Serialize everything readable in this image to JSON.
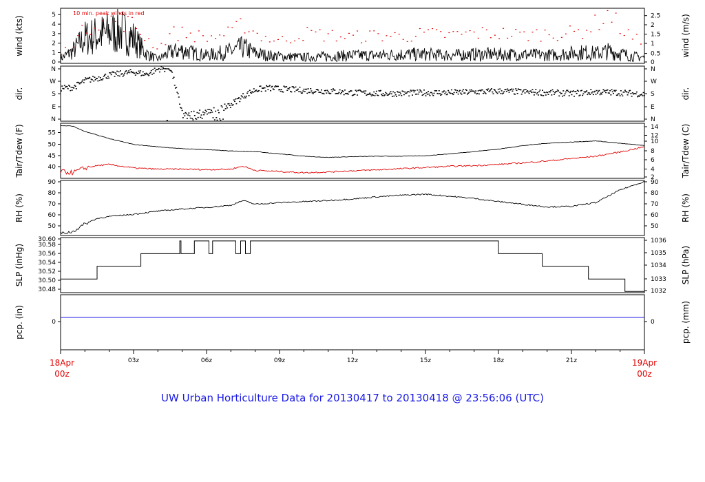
{
  "title": "UW Urban Horticulture Data for 20130417  to  20130418 @ 23:56:06  (UTC)",
  "colors": {
    "line": "#000000",
    "peak": "#e00000",
    "dew": "#e00000",
    "precip": "#1a1ae6",
    "title": "#1a1ae6",
    "end_labels": "#e00000"
  },
  "x_axis": {
    "start_label": [
      "18Apr",
      "00z"
    ],
    "end_label": [
      "19Apr",
      "00z"
    ],
    "tick_labels": [
      "03z",
      "06z",
      "09z",
      "12z",
      "15z",
      "18z",
      "21z"
    ]
  },
  "chart_data": [
    {
      "name": "wind",
      "type": "line",
      "ylabel_left": "wind (kts)",
      "ylabel_right": "wind (m/s)",
      "annotation": "10 min. peak winds in red",
      "ylim": [
        0,
        5.5
      ],
      "y_ticks_left": [
        "0",
        "1",
        "2",
        "3",
        "4",
        "5"
      ],
      "y_ticks_right": [
        "0",
        "0.5",
        "1",
        "1.5",
        "2",
        "2.5"
      ],
      "x_hours": [
        0,
        0.5,
        1,
        1.5,
        2,
        2.5,
        3,
        3.5,
        4,
        4.5,
        5,
        5.5,
        6,
        6.5,
        7,
        7.5,
        8,
        8.5,
        9,
        10,
        11,
        12,
        13,
        14,
        15,
        16,
        17,
        18,
        19,
        20,
        21,
        21.5,
        22,
        22.5,
        23,
        23.5,
        24
      ],
      "values": [
        0.5,
        1.2,
        2.5,
        2.8,
        3.0,
        3.2,
        2.5,
        1.0,
        0.4,
        1.1,
        1.3,
        1.0,
        0.8,
        1.0,
        1.2,
        1.6,
        1.0,
        0.8,
        0.7,
        0.6,
        0.7,
        0.8,
        0.8,
        0.9,
        0.9,
        0.8,
        0.9,
        0.9,
        0.9,
        0.8,
        1.0,
        1.1,
        1.0,
        1.2,
        1.0,
        0.7,
        0.6
      ],
      "peak_values": [
        1.0,
        2.0,
        3.5,
        4.3,
        4.5,
        4.2,
        3.8,
        2.5,
        1.5,
        3.0,
        3.0,
        2.8,
        2.5,
        2.8,
        3.0,
        4.0,
        3.0,
        2.5,
        2.2,
        3.0,
        2.8,
        2.6,
        2.8,
        2.7,
        2.9,
        2.8,
        3.0,
        3.0,
        2.8,
        3.0,
        3.0,
        3.3,
        4.0,
        5.0,
        3.5,
        2.5,
        2.0
      ]
    },
    {
      "name": "dir",
      "type": "scatter",
      "ylabel_left": "dir.",
      "ylabel_right": "dir.",
      "ylim": [
        0,
        360
      ],
      "y_ticks_left": [
        "N",
        "E",
        "S",
        "W",
        "N"
      ],
      "y_ticks_right": [
        "N",
        "E",
        "S",
        "W",
        "N"
      ],
      "x_hours": [
        0,
        0.5,
        1,
        1.5,
        2,
        2.5,
        3,
        3.5,
        4,
        4.5,
        5,
        5.5,
        6,
        6.5,
        7,
        7.5,
        8,
        8.5,
        9,
        10,
        11,
        12,
        13,
        14,
        15,
        16,
        17,
        18,
        19,
        20,
        21,
        22,
        23,
        24
      ],
      "values": [
        215,
        220,
        265,
        280,
        300,
        310,
        320,
        305,
        340,
        345,
        40,
        50,
        60,
        75,
        110,
        165,
        205,
        215,
        210,
        200,
        195,
        185,
        180,
        180,
        185,
        185,
        190,
        195,
        190,
        185,
        180,
        190,
        185,
        175
      ]
    },
    {
      "name": "temp",
      "type": "line",
      "ylabel_left": "Tair/Tdew (F)",
      "ylabel_right": "Tair/Tdew (C)",
      "ylim": [
        35.6,
        59.0
      ],
      "y_ticks_left": [
        "40",
        "45",
        "50",
        "55"
      ],
      "y_ticks_right": [
        "2",
        "4",
        "6",
        "8",
        "10",
        "12",
        "14"
      ],
      "series": [
        {
          "name": "Tair",
          "x_hours": [
            0,
            0.5,
            1,
            1.5,
            2,
            3,
            4,
            5,
            6,
            7,
            8,
            9,
            10,
            11,
            12,
            13,
            14,
            15,
            16,
            17,
            18,
            19,
            20,
            21,
            22,
            23,
            24
          ],
          "values": [
            58.0,
            57.8,
            55.5,
            54.0,
            52.5,
            50.0,
            49.0,
            48.2,
            47.8,
            47.2,
            47.0,
            46.0,
            45.0,
            44.5,
            44.8,
            45.0,
            45.0,
            45.2,
            46.0,
            47.0,
            48.0,
            49.5,
            50.5,
            51.0,
            51.5,
            50.5,
            49.5
          ]
        },
        {
          "name": "Tdew",
          "x_hours": [
            0,
            0.5,
            1,
            1.5,
            2,
            3,
            4,
            5,
            6,
            7,
            7.5,
            8,
            9,
            10,
            11,
            12,
            13,
            14,
            15,
            16,
            17,
            18,
            19,
            20,
            21,
            22,
            23,
            24
          ],
          "values": [
            38.5,
            38.0,
            40.0,
            41.0,
            41.5,
            40.0,
            39.5,
            39.5,
            39.3,
            39.5,
            40.8,
            39.0,
            38.5,
            38.0,
            38.3,
            38.8,
            39.2,
            39.7,
            40.2,
            40.7,
            41.0,
            41.5,
            42.2,
            43.0,
            44.0,
            45.0,
            46.8,
            49.0
          ]
        }
      ]
    },
    {
      "name": "rh",
      "type": "line",
      "ylabel_left": "RH (%)",
      "ylabel_right": "RH (%)",
      "ylim": [
        44,
        96
      ],
      "y_ticks_left": [
        "50",
        "60",
        "70",
        "80",
        "90"
      ],
      "y_ticks_right": [
        "50",
        "60",
        "70",
        "80",
        "90"
      ],
      "x_hours": [
        0,
        0.5,
        1,
        1.5,
        2,
        3,
        4,
        5,
        6,
        7,
        7.5,
        8,
        9,
        10,
        11,
        12,
        13,
        14,
        15,
        16,
        17,
        18,
        19,
        20,
        21,
        22,
        23,
        24
      ],
      "values": [
        46.0,
        47.5,
        55.0,
        60.0,
        62.0,
        64.0,
        67.0,
        69.0,
        70.5,
        72.5,
        77.0,
        73.5,
        75.0,
        76.0,
        77.0,
        78.5,
        80.5,
        82.0,
        83.0,
        81.0,
        79.0,
        76.0,
        73.5,
        71.0,
        71.5,
        75.0,
        87.0,
        95.0
      ]
    },
    {
      "name": "slp",
      "type": "line",
      "ylabel_left": "SLP (inHg)",
      "ylabel_right": "SLP (hPa)",
      "ylim": [
        30.475,
        30.605
      ],
      "y_ticks_left": [
        "30.48",
        "30.50",
        "30.52",
        "30.54",
        "30.56",
        "30.58",
        "30.60"
      ],
      "y_ticks_right": [
        "1032",
        "1033",
        "1034",
        "1035",
        "1036"
      ],
      "x_hours": [
        0,
        1.5,
        1.5,
        3.3,
        3.3,
        4.9,
        4.9,
        4.95,
        4.95,
        5.5,
        5.5,
        6.1,
        6.1,
        6.25,
        6.25,
        7.2,
        7.2,
        7.4,
        7.4,
        7.6,
        7.6,
        7.8,
        7.8,
        18.0,
        18.0,
        19.8,
        19.8,
        19.9,
        19.9,
        21.7,
        21.7,
        23.2,
        23.2,
        24.0
      ],
      "values": [
        30.507,
        30.507,
        30.537,
        30.537,
        30.567,
        30.567,
        30.597,
        30.597,
        30.567,
        30.567,
        30.597,
        30.597,
        30.567,
        30.567,
        30.597,
        30.597,
        30.567,
        30.567,
        30.597,
        30.597,
        30.567,
        30.567,
        30.597,
        30.597,
        30.567,
        30.567,
        30.537,
        30.537,
        30.537,
        30.537,
        30.507,
        30.507,
        30.478,
        30.478
      ]
    },
    {
      "name": "pcp",
      "type": "line",
      "ylabel_left": "pcp. (in)",
      "ylabel_right": "pcp. (mm)",
      "ylim": [
        -0.5,
        0.35
      ],
      "y_ticks_left": [
        "0"
      ],
      "y_ticks_right": [
        "0"
      ],
      "x_hours": [
        0,
        24
      ],
      "values": [
        0,
        0
      ]
    }
  ]
}
